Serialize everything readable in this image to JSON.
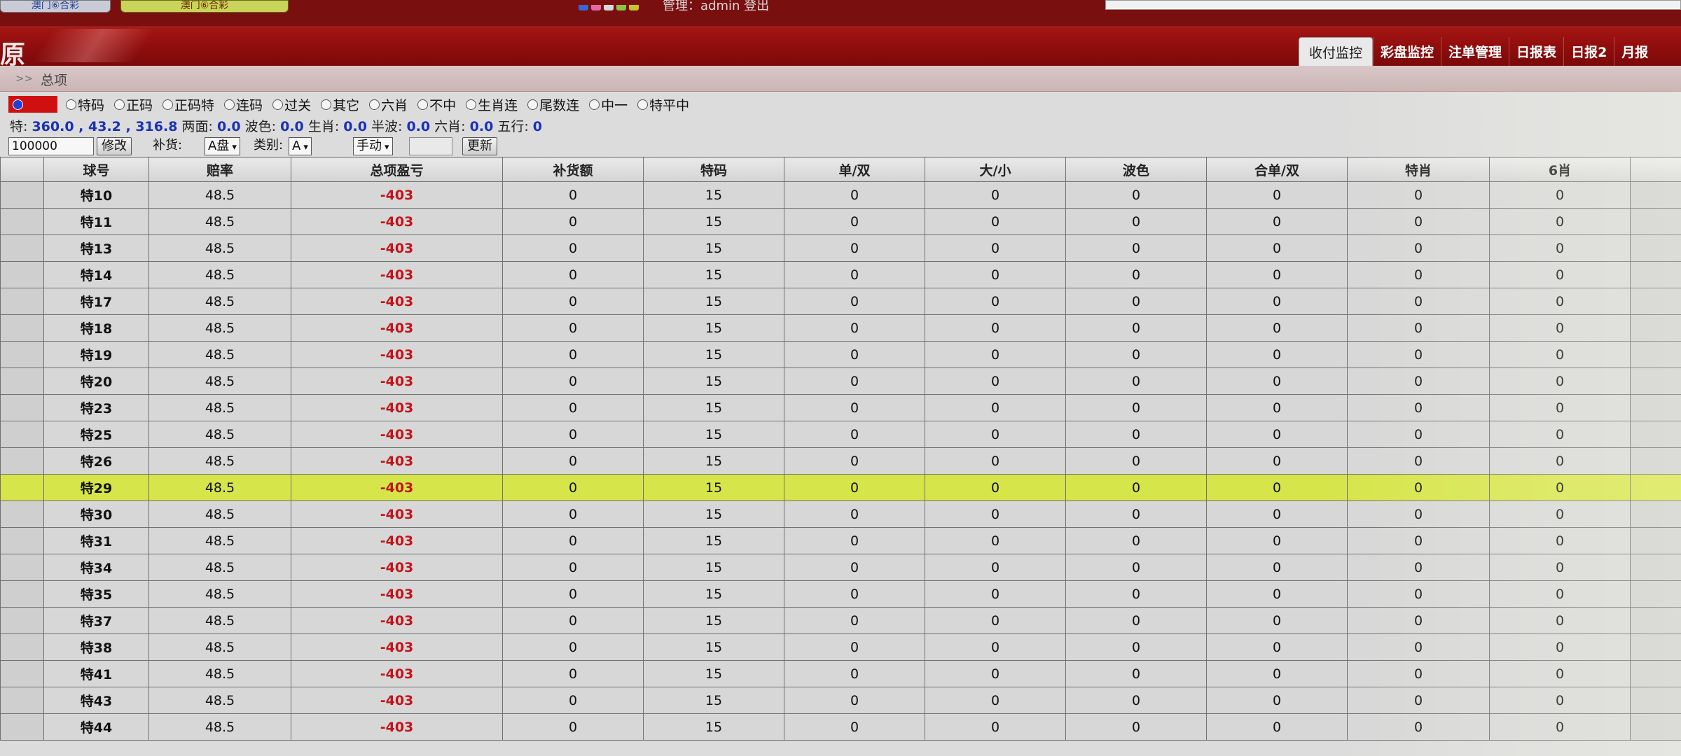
{
  "top": {
    "left_button": "澳门⑥合彩",
    "right_button": "澳门⑥合彩",
    "admin_line": "管理：admin 登出",
    "dot_colors": [
      "#3a64d8",
      "#e36aa6",
      "#d8d8d8",
      "#8ac34a",
      "#c6c22a"
    ]
  },
  "header": {
    "brand": "原",
    "tabs": [
      {
        "label": "收付监控",
        "active": true
      },
      {
        "label": "彩盘监控"
      },
      {
        "label": "注单管理"
      },
      {
        "label": "日报表"
      },
      {
        "label": "日报2"
      },
      {
        "label": "月报"
      }
    ]
  },
  "breadcrumb": {
    "separator": ">>",
    "title": "总项"
  },
  "options": {
    "items": [
      "特码",
      "正码",
      "正码特",
      "连码",
      "过关",
      "其它",
      "六肖",
      "不中",
      "生肖连",
      "尾数连",
      "中一",
      "特平中"
    ]
  },
  "stats": {
    "te_label": "特:",
    "te_value": "360.0 , 43.2 , 316.8",
    "liangmian_label": "两面:",
    "liangmian_value": "0.0",
    "bose_label": "波色:",
    "bose_value": "0.0",
    "shengxiao_label": "生肖:",
    "shengxiao_value": "0.0",
    "banbo_label": "半波:",
    "banbo_value": "0.0",
    "liuxiao_label": "六肖:",
    "liuxiao_value": "0.0",
    "wuxing_label": "五行:",
    "wuxing_value": "0"
  },
  "controls": {
    "amount": "100000",
    "modify_label": "修改",
    "buhuo_label": "补货:",
    "pan_value": "A盘",
    "type_label": "类别:",
    "type_value": "A",
    "mode_value": "手动",
    "update_label": "更新"
  },
  "table": {
    "columns": [
      "球号",
      "赔率",
      "总项盈亏",
      "补货额",
      "特码",
      "单/双",
      "大/小",
      "波色",
      "合单/双",
      "特肖",
      "6肖"
    ],
    "rows": [
      {
        "ball": "特10",
        "color": "blue",
        "odds": "48.5",
        "pl": "-403",
        "buhuo": "0",
        "tema": "15",
        "danshuang": "0",
        "daxiao": "0",
        "bose": "0",
        "hedanshuang": "0",
        "texiao": "0",
        "liuxiao": "0"
      },
      {
        "ball": "特11",
        "color": "green",
        "odds": "48.5",
        "pl": "-403",
        "buhuo": "0",
        "tema": "15",
        "danshuang": "0",
        "daxiao": "0",
        "bose": "0",
        "hedanshuang": "0",
        "texiao": "0",
        "liuxiao": "0"
      },
      {
        "ball": "特13",
        "color": "red",
        "odds": "48.5",
        "pl": "-403",
        "buhuo": "0",
        "tema": "15",
        "danshuang": "0",
        "daxiao": "0",
        "bose": "0",
        "hedanshuang": "0",
        "texiao": "0",
        "liuxiao": "0"
      },
      {
        "ball": "特14",
        "color": "blue",
        "odds": "48.5",
        "pl": "-403",
        "buhuo": "0",
        "tema": "15",
        "danshuang": "0",
        "daxiao": "0",
        "bose": "0",
        "hedanshuang": "0",
        "texiao": "0",
        "liuxiao": "0"
      },
      {
        "ball": "特17",
        "color": "green",
        "odds": "48.5",
        "pl": "-403",
        "buhuo": "0",
        "tema": "15",
        "danshuang": "0",
        "daxiao": "0",
        "bose": "0",
        "hedanshuang": "0",
        "texiao": "0",
        "liuxiao": "0"
      },
      {
        "ball": "特18",
        "color": "red",
        "odds": "48.5",
        "pl": "-403",
        "buhuo": "0",
        "tema": "15",
        "danshuang": "0",
        "daxiao": "0",
        "bose": "0",
        "hedanshuang": "0",
        "texiao": "0",
        "liuxiao": "0"
      },
      {
        "ball": "特19",
        "color": "red",
        "odds": "48.5",
        "pl": "-403",
        "buhuo": "0",
        "tema": "15",
        "danshuang": "0",
        "daxiao": "0",
        "bose": "0",
        "hedanshuang": "0",
        "texiao": "0",
        "liuxiao": "0"
      },
      {
        "ball": "特20",
        "color": "blue",
        "odds": "48.5",
        "pl": "-403",
        "buhuo": "0",
        "tema": "15",
        "danshuang": "0",
        "daxiao": "0",
        "bose": "0",
        "hedanshuang": "0",
        "texiao": "0",
        "liuxiao": "0"
      },
      {
        "ball": "特23",
        "color": "red",
        "odds": "48.5",
        "pl": "-403",
        "buhuo": "0",
        "tema": "15",
        "danshuang": "0",
        "daxiao": "0",
        "bose": "0",
        "hedanshuang": "0",
        "texiao": "0",
        "liuxiao": "0"
      },
      {
        "ball": "特25",
        "color": "blue",
        "odds": "48.5",
        "pl": "-403",
        "buhuo": "0",
        "tema": "15",
        "danshuang": "0",
        "daxiao": "0",
        "bose": "0",
        "hedanshuang": "0",
        "texiao": "0",
        "liuxiao": "0"
      },
      {
        "ball": "特26",
        "color": "blue",
        "odds": "48.5",
        "pl": "-403",
        "buhuo": "0",
        "tema": "15",
        "danshuang": "0",
        "daxiao": "0",
        "bose": "0",
        "hedanshuang": "0",
        "texiao": "0",
        "liuxiao": "0"
      },
      {
        "ball": "特29",
        "color": "red",
        "odds": "48.5",
        "pl": "-403",
        "buhuo": "0",
        "tema": "15",
        "danshuang": "0",
        "daxiao": "0",
        "bose": "0",
        "hedanshuang": "0",
        "texiao": "0",
        "liuxiao": "0",
        "highlight": true
      },
      {
        "ball": "特30",
        "color": "red",
        "odds": "48.5",
        "pl": "-403",
        "buhuo": "0",
        "tema": "15",
        "danshuang": "0",
        "daxiao": "0",
        "bose": "0",
        "hedanshuang": "0",
        "texiao": "0",
        "liuxiao": "0"
      },
      {
        "ball": "特31",
        "color": "blue",
        "odds": "48.5",
        "pl": "-403",
        "buhuo": "0",
        "tema": "15",
        "danshuang": "0",
        "daxiao": "0",
        "bose": "0",
        "hedanshuang": "0",
        "texiao": "0",
        "liuxiao": "0"
      },
      {
        "ball": "特34",
        "color": "red",
        "odds": "48.5",
        "pl": "-403",
        "buhuo": "0",
        "tema": "15",
        "danshuang": "0",
        "daxiao": "0",
        "bose": "0",
        "hedanshuang": "0",
        "texiao": "0",
        "liuxiao": "0"
      },
      {
        "ball": "特35",
        "color": "red",
        "odds": "48.5",
        "pl": "-403",
        "buhuo": "0",
        "tema": "15",
        "danshuang": "0",
        "daxiao": "0",
        "bose": "0",
        "hedanshuang": "0",
        "texiao": "0",
        "liuxiao": "0"
      },
      {
        "ball": "特37",
        "color": "blue",
        "odds": "48.5",
        "pl": "-403",
        "buhuo": "0",
        "tema": "15",
        "danshuang": "0",
        "daxiao": "0",
        "bose": "0",
        "hedanshuang": "0",
        "texiao": "0",
        "liuxiao": "0"
      },
      {
        "ball": "特38",
        "color": "green",
        "odds": "48.5",
        "pl": "-403",
        "buhuo": "0",
        "tema": "15",
        "danshuang": "0",
        "daxiao": "0",
        "bose": "0",
        "hedanshuang": "0",
        "texiao": "0",
        "liuxiao": "0"
      },
      {
        "ball": "特41",
        "color": "blue",
        "odds": "48.5",
        "pl": "-403",
        "buhuo": "0",
        "tema": "15",
        "danshuang": "0",
        "daxiao": "0",
        "bose": "0",
        "hedanshuang": "0",
        "texiao": "0",
        "liuxiao": "0"
      },
      {
        "ball": "特43",
        "color": "green",
        "odds": "48.5",
        "pl": "-403",
        "buhuo": "0",
        "tema": "15",
        "danshuang": "0",
        "daxiao": "0",
        "bose": "0",
        "hedanshuang": "0",
        "texiao": "0",
        "liuxiao": "0"
      },
      {
        "ball": "特44",
        "color": "green",
        "odds": "48.5",
        "pl": "-403",
        "buhuo": "0",
        "tema": "15",
        "danshuang": "0",
        "daxiao": "0",
        "bose": "0",
        "hedanshuang": "0",
        "texiao": "0",
        "liuxiao": "0"
      }
    ]
  },
  "colors": {
    "header_red": "#8e0d0d",
    "highlight_row": "#d6e54a",
    "loss_red": "#c0141a",
    "ball_blue": "#1c3bc4",
    "ball_red": "#c91a1a",
    "ball_green": "#138a1a",
    "stat_value_blue": "#1a30b5"
  }
}
